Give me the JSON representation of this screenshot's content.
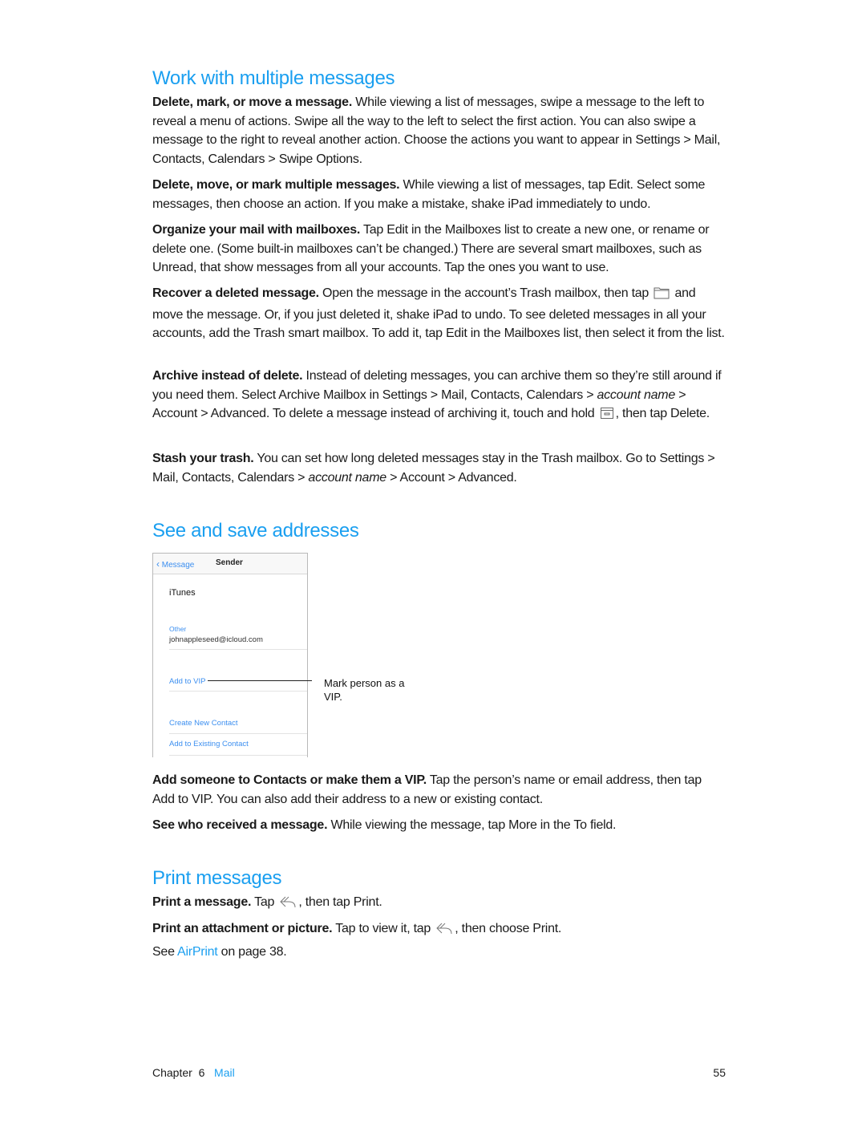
{
  "sections": {
    "work": {
      "heading": "Work with multiple messages",
      "p1": {
        "bold": "Delete, mark, or move a message.",
        "text": " While viewing a list of messages, swipe a message to the left to reveal a menu of actions. Swipe all the way to the left to select the first action. You can also swipe a message to the right to reveal another action. Choose the actions you want to appear in Settings > Mail, Contacts, Calendars > Swipe Options."
      },
      "p2": {
        "bold": "Delete, move, or mark multiple messages.",
        "text": " While viewing a list of messages, tap Edit. Select some messages, then choose an action. If you make a mistake, shake iPad immediately to undo."
      },
      "p3": {
        "bold": "Organize your mail with mailboxes.",
        "text": " Tap Edit in the Mailboxes list to create a new one, or rename or delete one. (Some built-in mailboxes can’t be changed.) There are several smart mailboxes, such as Unread, that show messages from all your accounts. Tap the ones you want to use."
      },
      "p4": {
        "bold": "Recover a deleted message.",
        "text_a": " Open the message in the account’s Trash mailbox, then tap ",
        "icon": "folder-icon",
        "text_b": " and move the message. Or, if you just deleted it, shake iPad to undo. To see deleted messages in all your accounts, add the Trash smart mailbox. To add it, tap Edit in the Mailboxes list, then select it from the list."
      },
      "p5": {
        "bold": "Archive instead of delete.",
        "text_a": " Instead of deleting messages, you can archive them so they’re still around if you need them. Select Archive Mailbox in Settings > Mail, Contacts, Calendars > ",
        "italic": "account name",
        "text_b": " > Account > Advanced. To delete a message instead of archiving it, touch and hold ",
        "icon": "archive-icon",
        "text_c": ", then tap Delete."
      },
      "p6": {
        "bold": "Stash your trash.",
        "text_a": " You can set how long deleted messages stay in the Trash mailbox. Go to Settings > Mail, Contacts, Calendars > ",
        "italic": "account name",
        "text_b": " > Account > Advanced."
      }
    },
    "addresses": {
      "heading": "See and save addresses",
      "screenshot": {
        "back_label": "Message",
        "nav_title": "Sender",
        "contact_name": "iTunes",
        "email_label": "Other",
        "email_value": "johnappleseed@icloud.com",
        "add_vip": "Add to VIP",
        "create_contact": "Create New Contact",
        "add_existing": "Add to Existing Contact"
      },
      "callout": "Mark person as a VIP.",
      "p1": {
        "bold": "Add someone to Contacts or make them a VIP.",
        "text": " Tap the person’s name or email address, then tap Add to VIP. You can also add their address to a new or existing contact."
      },
      "p2": {
        "bold": "See who received a message.",
        "text": " While viewing the message, tap More in the To field."
      }
    },
    "print": {
      "heading": "Print messages",
      "p1": {
        "bold": "Print a message.",
        "text_a": " Tap ",
        "icon": "reply-icon",
        "text_b": ", then tap Print."
      },
      "p2": {
        "bold": "Print an attachment or picture.",
        "text_a": " Tap to view it, tap ",
        "icon": "reply-icon",
        "text_b": ", then choose Print."
      },
      "p3": {
        "text_a": "See ",
        "link": "AirPrint",
        "text_b": " on page 38."
      }
    }
  },
  "footer": {
    "chapter": "Chapter  6",
    "chapter_name": "Mail",
    "page_number": "55"
  },
  "colors": {
    "accent": "#1a9ff0",
    "text": "#1a1a1a"
  }
}
